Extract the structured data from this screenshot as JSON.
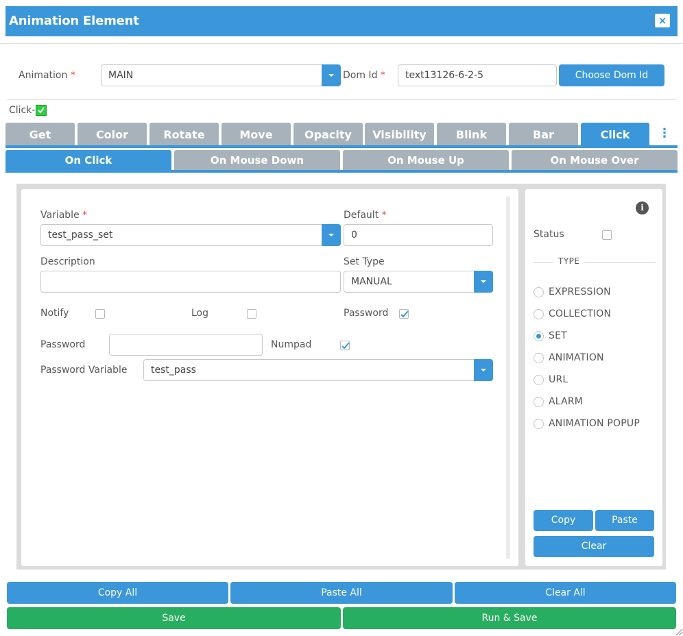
{
  "window": {
    "title": "Animation Element",
    "close_icon": "×"
  },
  "header_form": {
    "animation_label": "Animation",
    "animation_value": "MAIN",
    "dom_id_label": "Dom Id",
    "dom_id_value": "text13126-6-2-5",
    "choose_dom_id_label": "Choose Dom Id",
    "required_marker": "*"
  },
  "click_toggle": {
    "label": "Click-",
    "checked": true
  },
  "tabs": [
    {
      "label": "Get"
    },
    {
      "label": "Color"
    },
    {
      "label": "Rotate"
    },
    {
      "label": "Move"
    },
    {
      "label": "Opacity"
    },
    {
      "label": "Visibility"
    },
    {
      "label": "Blink"
    },
    {
      "label": "Bar"
    },
    {
      "label": "Click",
      "active": true
    }
  ],
  "tabs_more_icon": "⋮",
  "subtabs": [
    {
      "label": "On Click",
      "active": true
    },
    {
      "label": "On Mouse Down"
    },
    {
      "label": "On Mouse Up"
    },
    {
      "label": "On Mouse Over"
    }
  ],
  "form": {
    "variable_label": "Variable",
    "variable_value": "test_pass_set",
    "default_label": "Default",
    "default_value": "0",
    "description_label": "Description",
    "description_value": "",
    "set_type_label": "Set Type",
    "set_type_value": "MANUAL",
    "notify_label": "Notify",
    "log_label": "Log",
    "password_check_label": "Password",
    "password_label": "Password",
    "password_value": "",
    "numpad_label": "Numpad",
    "password_variable_label": "Password Variable",
    "password_variable_value": "test_pass"
  },
  "side_panel": {
    "info_icon": "i",
    "status_label": "Status",
    "type_legend": "TYPE",
    "types": [
      {
        "label": "EXPRESSION"
      },
      {
        "label": "COLLECTION"
      },
      {
        "label": "SET",
        "selected": true
      },
      {
        "label": "ANIMATION"
      },
      {
        "label": "URL"
      },
      {
        "label": "ALARM"
      },
      {
        "label": "ANIMATION POPUP"
      }
    ],
    "copy_label": "Copy",
    "paste_label": "Paste",
    "clear_label": "Clear"
  },
  "footer": {
    "copy_all_label": "Copy All",
    "paste_all_label": "Paste All",
    "clear_all_label": "Clear All",
    "save_label": "Save",
    "run_save_label": "Run & Save"
  },
  "colors": {
    "primary": "#3b97d9",
    "success": "#27ae60",
    "tab_inactive": "#a7b2bb",
    "required": "#e74c3c"
  }
}
